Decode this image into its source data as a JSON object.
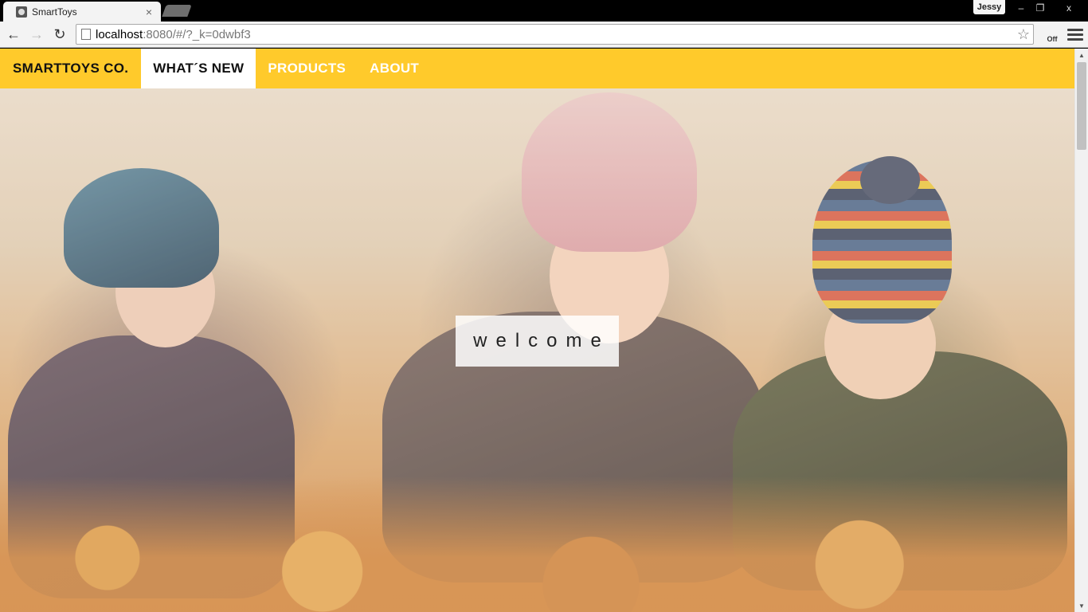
{
  "browser": {
    "tab_title": "SmartToys",
    "tab_close": "×",
    "user_name": "Jessy",
    "window_controls": {
      "minimize": "–",
      "restore": "❐",
      "close": "x"
    },
    "nav": {
      "back": "←",
      "forward": "→",
      "reload": "↻"
    },
    "url_host": "localhost",
    "url_rest": ":8080/#/?_k=0dwbf3",
    "bookmark_star": "☆",
    "extension_label": "Off"
  },
  "site": {
    "brand": "SMARTTOYS CO.",
    "nav_items": [
      {
        "label": "WHAT´S NEW",
        "active": true
      },
      {
        "label": "PRODUCTS",
        "active": false
      },
      {
        "label": "ABOUT",
        "active": false
      }
    ],
    "hero_text": "welcome"
  },
  "colors": {
    "navbar": "#ffca2b",
    "nav_active_bg": "#ffffff",
    "nav_text": "#ffffff"
  },
  "scrollbar": {
    "up": "▲",
    "down": "▼"
  }
}
